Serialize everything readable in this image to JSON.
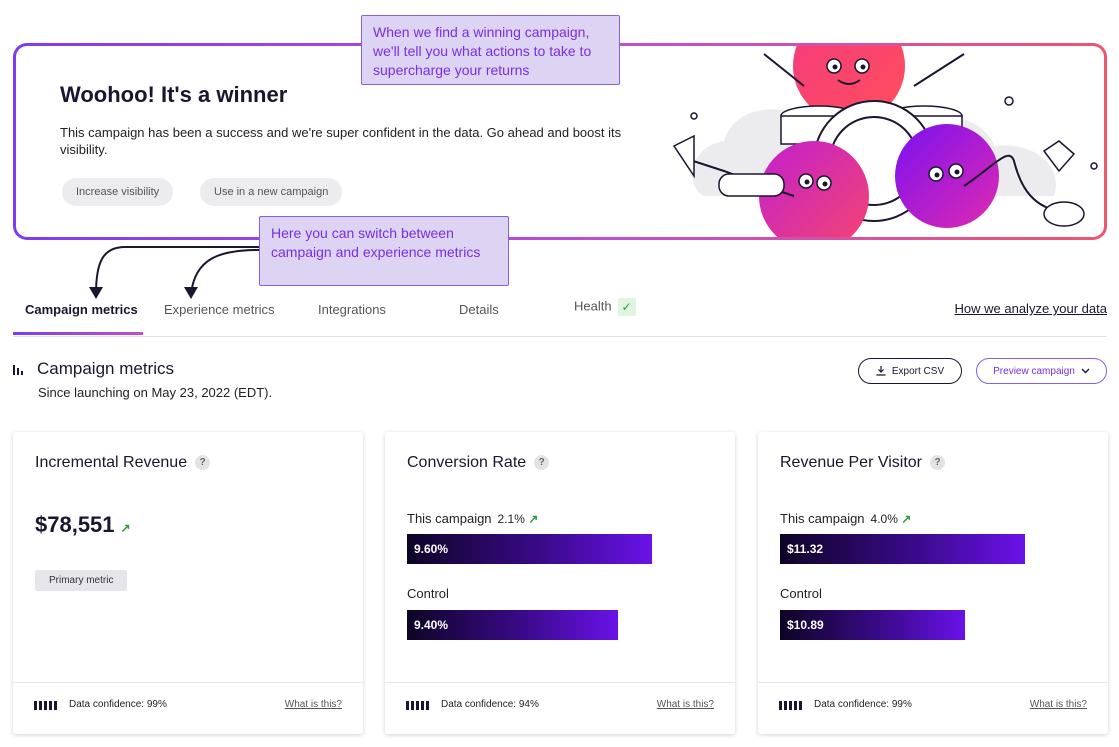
{
  "banner": {
    "title": "Woohoo! It's a winner",
    "text": "This campaign has been a success and we're super confident in the data. Go ahead and boost its visibility.",
    "buttons": [
      "Increase visibility",
      "Use in a new campaign"
    ]
  },
  "callouts": {
    "top": "When we find a winning campaign, we'll tell you what actions to take to supercharge your returns",
    "tabs": "Here you can switch between campaign and experience metrics"
  },
  "tabs": [
    {
      "label": "Campaign metrics",
      "active": true
    },
    {
      "label": "Experience metrics",
      "active": false
    },
    {
      "label": "Integrations",
      "active": false
    },
    {
      "label": "Details",
      "active": false
    },
    {
      "label": "Health",
      "active": false,
      "icon": "check-icon"
    }
  ],
  "analyze_link": "How we analyze your data",
  "section": {
    "icon": "bar-chart-icon",
    "title": "Campaign metrics",
    "subtitle": "Since launching on May 23, 2022 (EDT).",
    "export_label": "Export CSV",
    "preview_label": "Preview campaign"
  },
  "cards": [
    {
      "title": "Incremental Revenue",
      "value": "$78,551",
      "badge": "Primary metric",
      "confidence": "Data confidence: 99%",
      "link": "What is this?"
    },
    {
      "title": "Conversion Rate",
      "campaign_label": "This campaign",
      "campaign_delta": "2.1%",
      "campaign_value": "9.60%",
      "campaign_fraction": 1.0,
      "control_label": "Control",
      "control_value": "9.40%",
      "control_fraction": 0.86,
      "confidence": "Data confidence: 94%",
      "link": "What is this?"
    },
    {
      "title": "Revenue Per Visitor",
      "campaign_label": "This campaign",
      "campaign_delta": "4.0%",
      "campaign_value": "$11.32",
      "campaign_fraction": 1.0,
      "control_label": "Control",
      "control_value": "$10.89",
      "control_fraction": 0.755,
      "confidence": "Data confidence: 99%",
      "link": "What is this?"
    }
  ],
  "colors": {
    "accent": "#7d3cf2",
    "gradient_end": "#f0556f",
    "bar_dark": "#0e0426",
    "bar_light": "#6a12e8",
    "positive": "#2e9a3a"
  }
}
